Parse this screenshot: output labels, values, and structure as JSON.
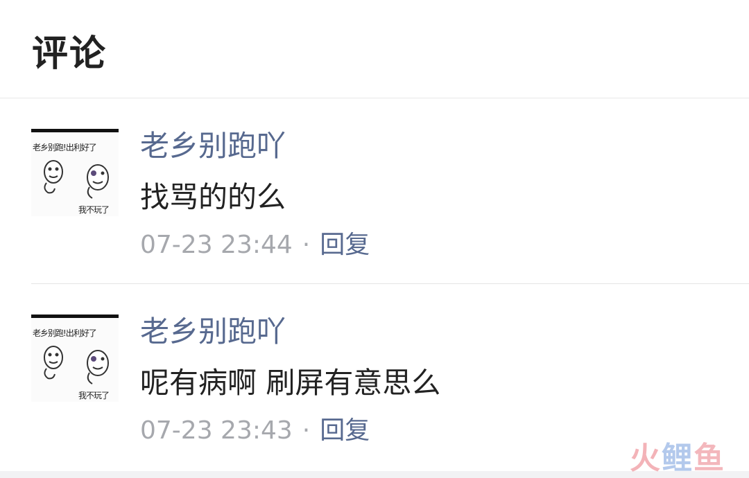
{
  "header": {
    "title": "评论"
  },
  "comments": [
    {
      "avatar_caption_top": "老乡别跑!出利好了",
      "avatar_caption_bottom": "我不玩了",
      "username": "老乡别跑吖",
      "text": "找骂的的么",
      "timestamp": "07-23 23:44",
      "separator": "·",
      "reply_label": "回复"
    },
    {
      "avatar_caption_top": "老乡别跑!出利好了",
      "avatar_caption_bottom": "我不玩了",
      "username": "老乡别跑吖",
      "text": "呢有病啊 刷屏有意思么",
      "timestamp": "07-23 23:43",
      "separator": "·",
      "reply_label": "回复"
    }
  ],
  "watermark": {
    "char1": "火",
    "char2": "鲤",
    "char3": "鱼"
  }
}
